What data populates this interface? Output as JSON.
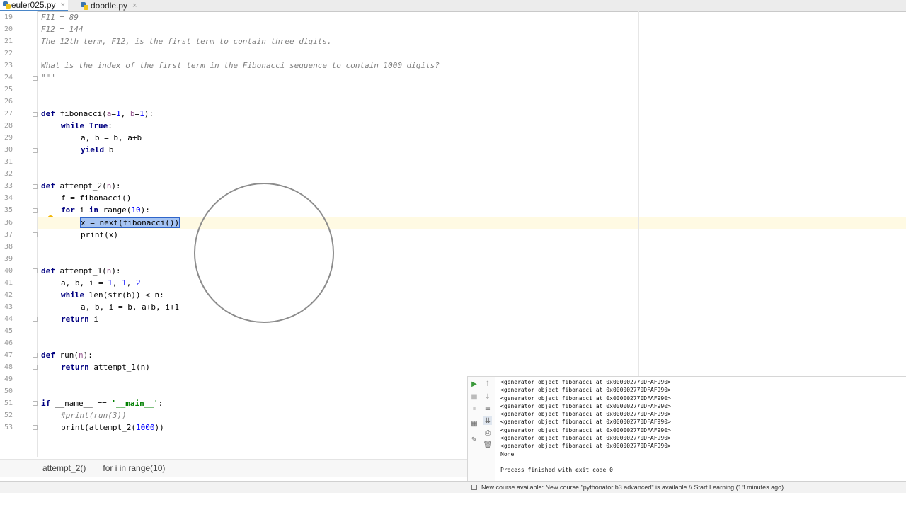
{
  "tabs": [
    {
      "label": "euler025.py",
      "active": true
    },
    {
      "label": "doodle.py",
      "active": false
    }
  ],
  "close_glyph": "×",
  "line_numbers": [
    "19",
    "20",
    "21",
    "22",
    "23",
    "24",
    "25",
    "26",
    "27",
    "28",
    "29",
    "30",
    "31",
    "32",
    "33",
    "34",
    "35",
    "36",
    "37",
    "38",
    "39",
    "40",
    "41",
    "42",
    "43",
    "44",
    "45",
    "46",
    "47",
    "48",
    "49",
    "50",
    "51",
    "52",
    "53"
  ],
  "code": {
    "l19": "F11 = 89",
    "l20": "F12 = 144",
    "l21": "The 12th term, F12, is the first term to contain three digits.",
    "l23": "What is the index of the first term in the Fibonacci sequence to contain 1000 digits?",
    "l24": "\"\"\"",
    "l27_kw": "def",
    "l27_name": " fibonacci(",
    "l27_a": "a",
    "l27_eq1": "=",
    "l27_n1": "1",
    "l27_sep": ", ",
    "l27_b": "b",
    "l27_eq2": "=",
    "l27_n2": "1",
    "l27_end": "):",
    "l28_kw": "while",
    "l28_true": " True",
    "l28_end": ":",
    "l29": "a, b = b, a+b",
    "l30_kw": "yield",
    "l30_rest": " b",
    "l33_kw": "def",
    "l33_name": " attempt_2(",
    "l33_n": "n",
    "l33_end": "):",
    "l34": "f = fibonacci()",
    "l35_kw1": "for",
    "l35_i": " i ",
    "l35_kw2": "in",
    "l35_rest": " range(",
    "l35_num": "10",
    "l35_end": "):",
    "l36_sel": "x = next(fibonacci())",
    "l37": "print(x)",
    "l40_kw": "def",
    "l40_name": " attempt_1(",
    "l40_n": "n",
    "l40_end": "):",
    "l41_pre": "a, b, i = ",
    "l41_n1": "1",
    "l41_s1": ", ",
    "l41_n2": "1",
    "l41_s2": ", ",
    "l41_n3": "2",
    "l42_kw": "while",
    "l42_rest": " len(str(b)) < n:",
    "l43": "a, b, i = b, a+b, i+1",
    "l44_kw": "return",
    "l44_rest": " i",
    "l47_kw": "def",
    "l47_name": " run(",
    "l47_n": "n",
    "l47_end": "):",
    "l48_kw": "return",
    "l48_rest": " attempt_1(n)",
    "l51_kw": "if",
    "l51_mid": " __name__ == ",
    "l51_str": "'__main__'",
    "l51_end": ":",
    "l52": "#print(run(3))",
    "l53_pre": "print(attempt_2(",
    "l53_num": "1000",
    "l53_end": "))"
  },
  "breadcrumbs": [
    "attempt_2()",
    "for i in range(10)"
  ],
  "console_lines": [
    "<generator object fibonacci at 0x000002770DFAF990>",
    "<generator object fibonacci at 0x000002770DFAF990>",
    "<generator object fibonacci at 0x000002770DFAF990>",
    "<generator object fibonacci at 0x000002770DFAF990>",
    "<generator object fibonacci at 0x000002770DFAF990>",
    "<generator object fibonacci at 0x000002770DFAF990>",
    "<generator object fibonacci at 0x000002770DFAF990>",
    "<generator object fibonacci at 0x000002770DFAF990>",
    "<generator object fibonacci at 0x000002770DFAF990>",
    "None",
    "",
    "Process finished with exit code 0"
  ],
  "status_text": "New course available: New course \"pythonator b3 advanced\" is available // Start Learning (18 minutes ago)",
  "run_tool_icons": [
    "run-icon",
    "up-arrow-icon",
    "stop-icon",
    "down-arrow-icon",
    "pause-icon",
    "soft-wrap-icon",
    "layout-icon",
    "scroll-to-end-icon",
    "pin-icon",
    "print-icon",
    "trash-icon"
  ],
  "colors": {
    "keyword": "#000080",
    "number": "#0000ff",
    "string": "#008000",
    "docstring": "#808080",
    "caret_row": "#fffae3",
    "selection": "#2f65ca"
  }
}
